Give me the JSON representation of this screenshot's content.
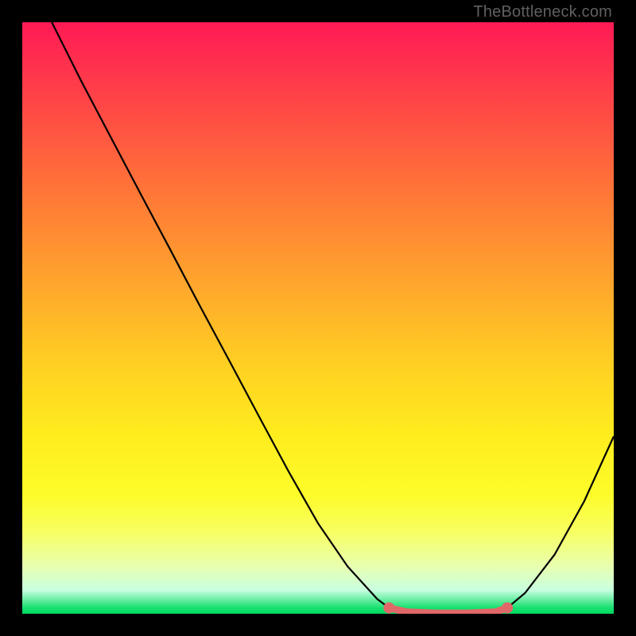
{
  "attribution": "TheBottleneck.com",
  "colors": {
    "page_bg": "#000000",
    "curve_stroke": "#000000",
    "highlight_stroke": "#e06868",
    "highlight_fill": "#e06868",
    "gradient_top": "#ff1a55",
    "gradient_bottom": "#00d860",
    "attribution_text": "#606060"
  },
  "chart_data": {
    "type": "line",
    "title": "",
    "xlabel": "",
    "ylabel": "",
    "x_range": [
      0,
      100
    ],
    "y_range": [
      0,
      100
    ],
    "curve": {
      "x": [
        5,
        10,
        15,
        20,
        25,
        30,
        35,
        40,
        45,
        50,
        55,
        60,
        62,
        65,
        70,
        75,
        80,
        82,
        85,
        90,
        95,
        100
      ],
      "y": [
        100,
        90,
        80.5,
        71,
        61.6,
        52.1,
        42.8,
        33.4,
        24.1,
        15.3,
        8.0,
        2.5,
        1.0,
        0.3,
        0.1,
        0.1,
        0.3,
        1.0,
        3.5,
        10.0,
        19.0,
        30.0
      ]
    },
    "highlight_segment": {
      "x_start": 62,
      "x_end": 82,
      "endpoint_left": {
        "x": 62,
        "y": 1.0
      },
      "endpoint_right": {
        "x": 82,
        "y": 1.0
      }
    },
    "notes": "Axes are unlabeled; values are normalized 0–100. y=0 at bottom, y=100 at top. The highlighted coral segment marks the low-bottleneck region roughly x∈[62,82]."
  }
}
